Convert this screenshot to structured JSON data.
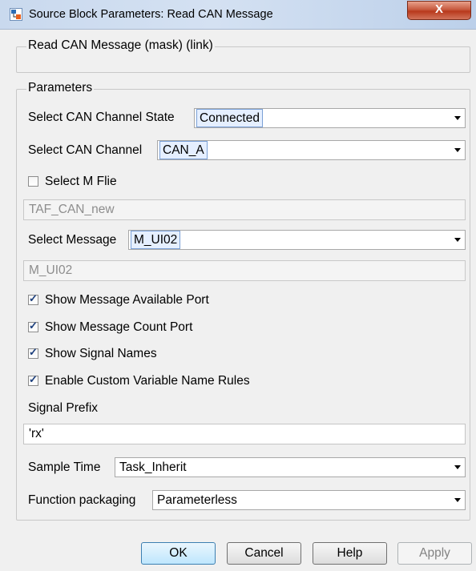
{
  "window": {
    "title": "Source Block Parameters: Read CAN Message",
    "close_glyph": "X"
  },
  "block": {
    "heading": "Read CAN Message (mask) (link)"
  },
  "parameters": {
    "group_label": "Parameters",
    "channel_state": {
      "label": "Select CAN Channel State",
      "value": "Connected"
    },
    "channel": {
      "label": "Select CAN Channel",
      "value": "CAN_A"
    },
    "select_m_file": {
      "label": "Select M Flie",
      "checked": false
    },
    "m_file_value": "TAF_CAN_new",
    "message": {
      "label": "Select Message",
      "value": "M_UI02"
    },
    "message_value": "M_UI02",
    "show_available_port": {
      "label": "Show Message Available Port",
      "checked": true
    },
    "show_count_port": {
      "label": "Show Message Count Port",
      "checked": true
    },
    "show_signal_names": {
      "label": "Show Signal Names",
      "checked": true
    },
    "custom_name_rules": {
      "label": "Enable Custom Variable Name Rules",
      "checked": true
    },
    "signal_prefix": {
      "label": "Signal Prefix",
      "value": "'rx'"
    },
    "sample_time": {
      "label": "Sample Time",
      "value": "Task_Inherit"
    },
    "function_packaging": {
      "label": "Function packaging",
      "value": "Parameterless"
    }
  },
  "buttons": {
    "ok": "OK",
    "cancel": "Cancel",
    "help": "Help",
    "apply": "Apply"
  },
  "check_glyph": "✓"
}
